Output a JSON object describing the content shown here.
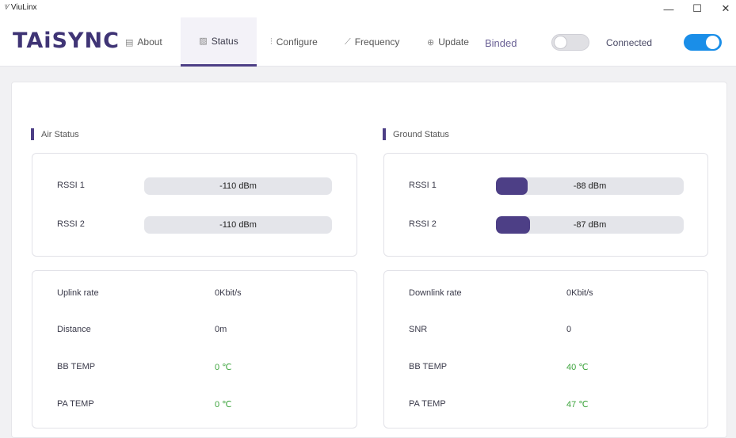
{
  "window": {
    "app_title": "ViuLinx",
    "minimize_glyph": "—",
    "maximize_glyph": "☐",
    "close_glyph": "✕"
  },
  "header": {
    "brand": "TAiSYNC",
    "tabs": [
      {
        "label": "About",
        "icon": "monitor-icon",
        "active": false
      },
      {
        "label": "Status",
        "icon": "image-icon",
        "active": true
      },
      {
        "label": "Configure",
        "icon": "sliders-icon",
        "active": false
      },
      {
        "label": "Frequency",
        "icon": "chart-line-icon",
        "active": false
      },
      {
        "label": "Update",
        "icon": "upload-circle-icon",
        "active": false
      }
    ],
    "binded_label": "Binded",
    "binded_on": false,
    "connected_label": "Connected",
    "connected_on": true
  },
  "colors": {
    "accent": "#4d3f86",
    "toggle_on": "#1a8ee8",
    "ok_green": "#3ea43e"
  },
  "air": {
    "title": "Air Status",
    "rssi": [
      {
        "label": "RSSI 1",
        "value": "-110 dBm",
        "level": 0
      },
      {
        "label": "RSSI 2",
        "value": "-110 dBm",
        "level": 0
      }
    ],
    "stats": [
      {
        "label": "Uplink rate",
        "value": "0Kbit/s",
        "green": false
      },
      {
        "label": "Distance",
        "value": "0m",
        "green": false
      },
      {
        "label": "BB TEMP",
        "value": "0 ℃",
        "green": true
      },
      {
        "label": "PA TEMP",
        "value": "0 ℃",
        "green": true
      }
    ]
  },
  "ground": {
    "title": "Ground Status",
    "rssi": [
      {
        "label": "RSSI 1",
        "value": "-88 dBm",
        "level": 0.17
      },
      {
        "label": "RSSI 2",
        "value": "-87 dBm",
        "level": 0.18
      }
    ],
    "stats": [
      {
        "label": "Downlink rate",
        "value": "0Kbit/s",
        "green": false
      },
      {
        "label": "SNR",
        "value": "0",
        "green": false
      },
      {
        "label": "BB TEMP",
        "value": "40 ℃",
        "green": true
      },
      {
        "label": "PA TEMP",
        "value": "47 ℃",
        "green": true
      }
    ]
  }
}
